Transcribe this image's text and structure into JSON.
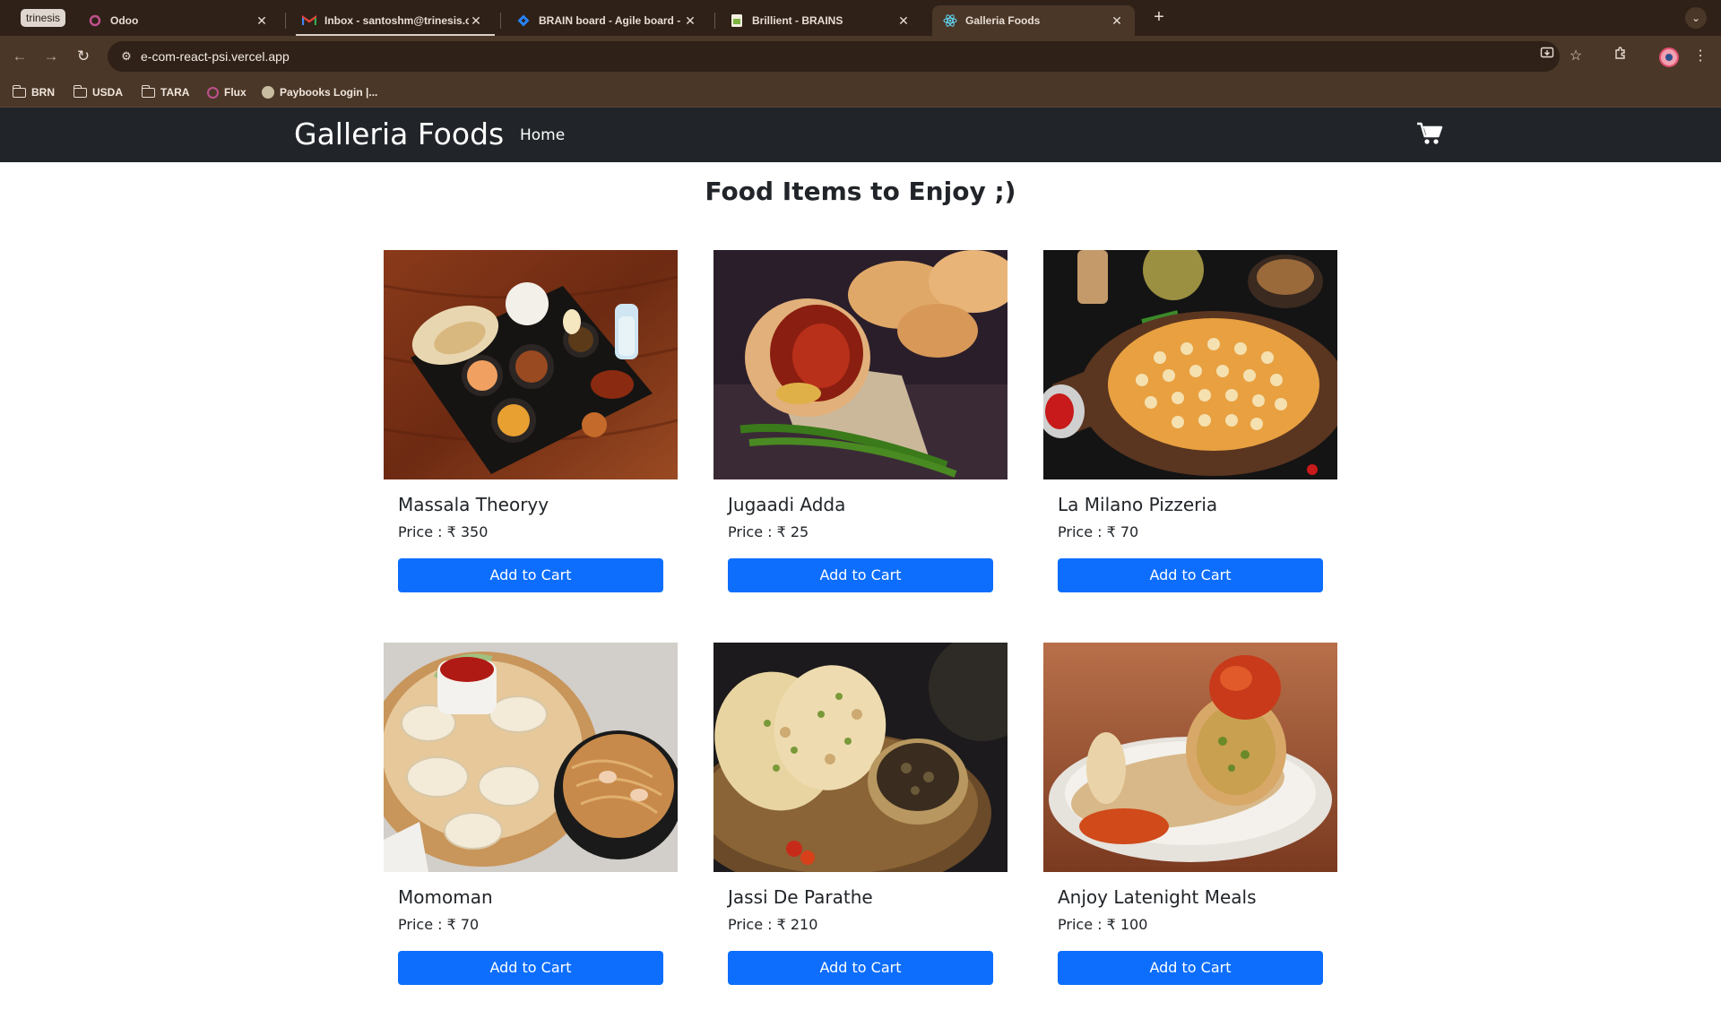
{
  "browser": {
    "profile_chip": "trinesis",
    "tabs": [
      {
        "title": "Odoo",
        "icon": "odoo-icon"
      },
      {
        "title": "Inbox - santoshm@trinesis.c",
        "icon": "gmail-icon"
      },
      {
        "title": "BRAIN board - Agile board -",
        "icon": "jira-icon"
      },
      {
        "title": "Brillient - BRAINS",
        "icon": "sheets-icon"
      },
      {
        "title": "Galleria Foods",
        "icon": "react-icon",
        "active": true
      }
    ],
    "url": "e-com-react-psi.vercel.app",
    "bookmarks": [
      {
        "label": "BRN",
        "icon": "folder-icon"
      },
      {
        "label": "USDA",
        "icon": "folder-icon"
      },
      {
        "label": "TARA",
        "icon": "folder-icon"
      },
      {
        "label": "Flux",
        "icon": "odoo-icon"
      },
      {
        "label": "Paybooks Login |...",
        "icon": "paybooks-icon"
      }
    ]
  },
  "site": {
    "brand": "Galleria Foods",
    "nav_home": "Home",
    "cart_icon": "cart-icon",
    "heading": "Food Items to Enjoy ;)",
    "button_color": "#0d6efd",
    "navbar_color": "#212529",
    "products": [
      {
        "name": "Massala Theoryy",
        "price": "Price : ₹ 350",
        "button": "Add to Cart"
      },
      {
        "name": "Jugaadi Adda",
        "price": "Price : ₹ 25",
        "button": "Add to Cart"
      },
      {
        "name": "La Milano Pizzeria",
        "price": "Price : ₹ 70",
        "button": "Add to Cart"
      },
      {
        "name": "Momoman",
        "price": "Price : ₹ 70",
        "button": "Add to Cart"
      },
      {
        "name": "Jassi De Parathe",
        "price": "Price : ₹ 210",
        "button": "Add to Cart"
      },
      {
        "name": "Anjoy Latenight Meals",
        "price": "Price : ₹ 100",
        "button": "Add to Cart"
      }
    ]
  }
}
